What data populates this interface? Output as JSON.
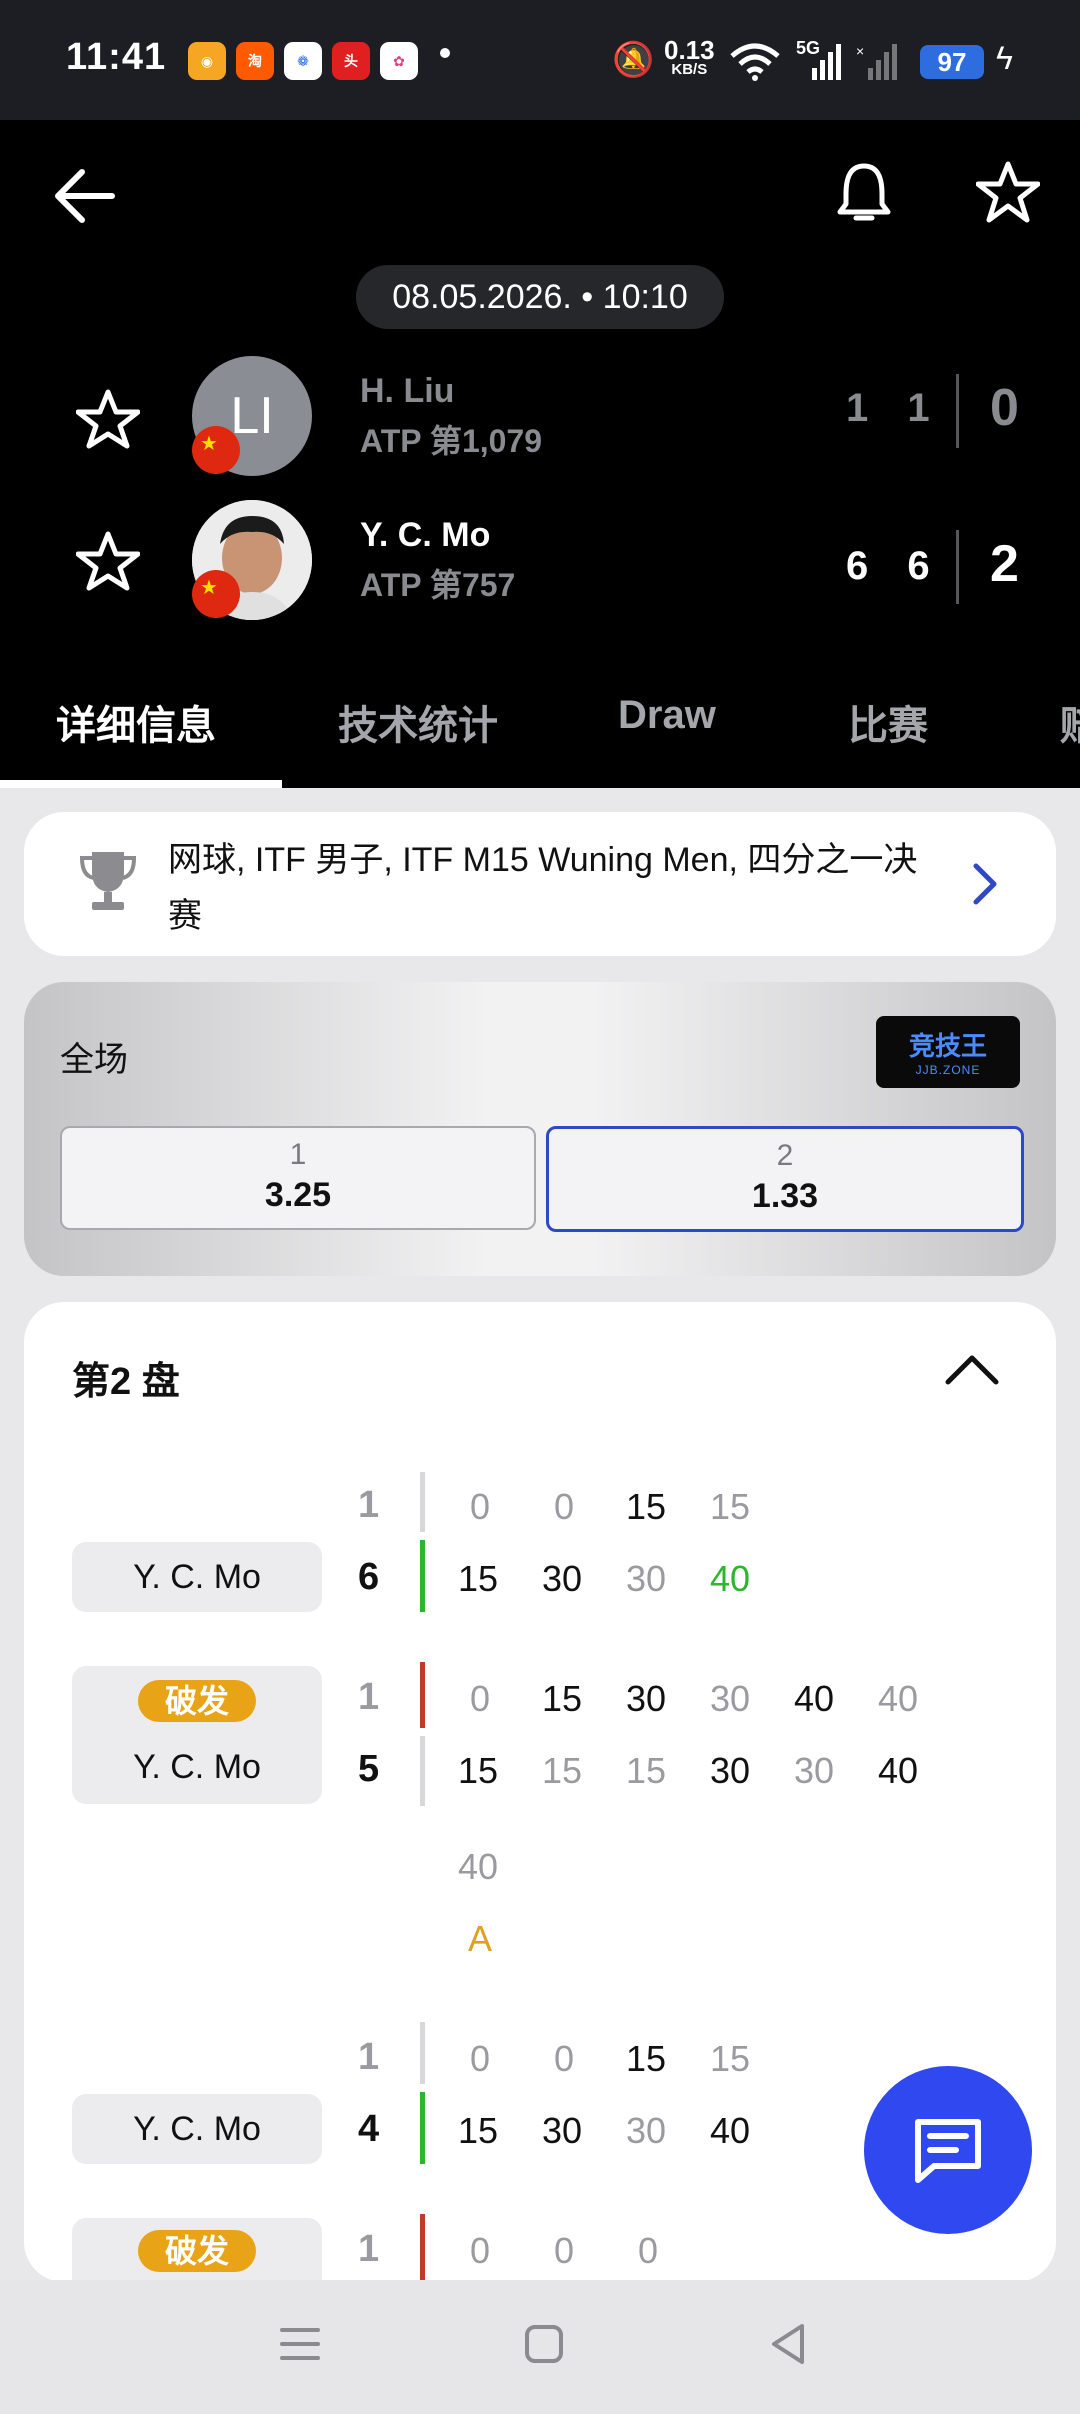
{
  "status_bar": {
    "time": "11:41",
    "net_speed": "0.13",
    "net_unit": "KB/S",
    "network": "5G",
    "battery": "97",
    "app_icons": [
      "weibo-icon",
      "taobao-flash-icon",
      "baidu-icon",
      "toutiao-icon",
      "photos-icon"
    ]
  },
  "header": {
    "datetime": "08.05.2026. • 10:10",
    "players": [
      {
        "name": "H. Liu",
        "rank": "ATP 第1,079",
        "initials": "LI",
        "sets": "1 1",
        "total": "0"
      },
      {
        "name": "Y. C. Mo",
        "rank": "ATP 第757",
        "sets": "6 6",
        "total": "2"
      }
    ]
  },
  "tabs": [
    "详细信息",
    "技术统计",
    "Draw",
    "比赛",
    "赔"
  ],
  "tournament": {
    "text": "网球, ITF 男子, ITF M15 Wuning Men, 四分之一决赛"
  },
  "odds": {
    "title": "全场",
    "brand": "竞技王",
    "brand_sub": "JJB.ZONE",
    "options": [
      {
        "label": "1",
        "value": "3.25"
      },
      {
        "label": "2",
        "value": "1.33"
      }
    ]
  },
  "set_section": {
    "title": "第2 盘",
    "games": [
      {
        "server": "Y. C. Mo",
        "top_game": "1",
        "bottom_game": "6",
        "top": [
          "0",
          "0",
          "15",
          "15"
        ],
        "bottom": [
          "15",
          "30",
          "30",
          "40"
        ]
      },
      {
        "badge": "破发",
        "server": "Y. C. Mo",
        "top_game": "1",
        "bottom_game": "5",
        "top": [
          "0",
          "15",
          "30",
          "30",
          "40",
          "40",
          "40"
        ],
        "bottom": [
          "15",
          "15",
          "15",
          "30",
          "30",
          "40",
          "A"
        ]
      },
      {
        "server": "Y. C. Mo",
        "top_game": "1",
        "bottom_game": "4",
        "top": [
          "0",
          "0",
          "15",
          "15"
        ],
        "bottom": [
          "15",
          "30",
          "30",
          "40"
        ]
      },
      {
        "badge": "破发",
        "top_game": "1",
        "top": [
          "0",
          "0",
          "0"
        ]
      }
    ]
  }
}
